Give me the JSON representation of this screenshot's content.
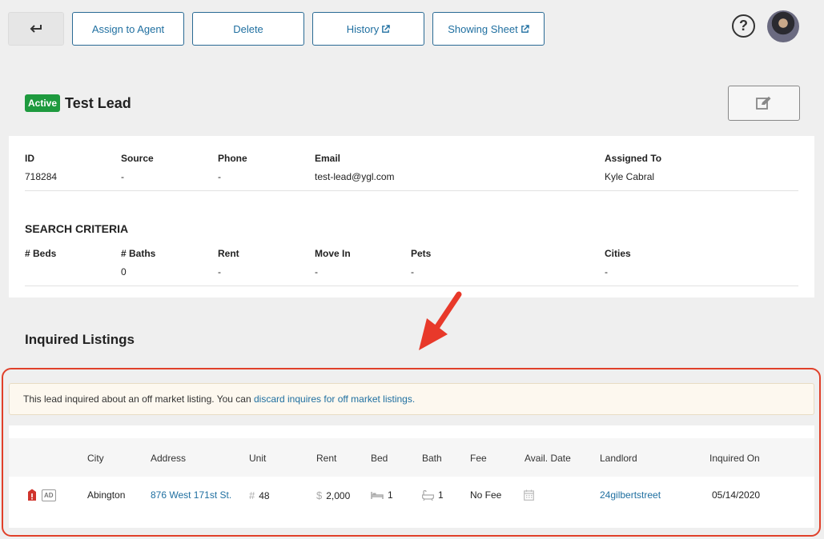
{
  "toolbar": {
    "assign_label": "Assign to Agent",
    "delete_label": "Delete",
    "history_label": "History",
    "showing_sheet_label": "Showing Sheet"
  },
  "lead": {
    "status": "Active",
    "name": "Test Lead"
  },
  "details": {
    "fields": [
      {
        "label": "ID",
        "value": "718284"
      },
      {
        "label": "Source",
        "value": "-"
      },
      {
        "label": "Phone",
        "value": "-"
      },
      {
        "label": "Email",
        "value": "test-lead@ygl.com"
      },
      {
        "label": "Assigned To",
        "value": "Kyle Cabral"
      }
    ]
  },
  "criteria": {
    "title": "SEARCH CRITERIA",
    "fields": [
      {
        "label": "# Beds",
        "value": ""
      },
      {
        "label": "# Baths",
        "value": "0"
      },
      {
        "label": "Rent",
        "value": "-"
      },
      {
        "label": "Move In",
        "value": "-"
      },
      {
        "label": "Pets",
        "value": "-"
      },
      {
        "label": "Cities",
        "value": "-"
      }
    ]
  },
  "inquired": {
    "title": "Inquired Listings",
    "notice_text": "This lead inquired about an off market listing. You can ",
    "notice_link": "discard inquires for off market listings.",
    "columns": [
      "City",
      "Address",
      "Unit",
      "Rent",
      "Bed",
      "Bath",
      "Fee",
      "Avail. Date",
      "Landlord",
      "Inquired On"
    ],
    "row": {
      "ad_badge": "AD",
      "city": "Abington",
      "address": "876 West 171st St.",
      "unit_prefix": "#",
      "unit": "48",
      "rent_prefix": "$",
      "rent": "2,000",
      "bed": "1",
      "bath": "1",
      "fee": "No Fee",
      "landlord": "24gilbertstreet",
      "inquired_on": "05/14/2020"
    }
  },
  "colors": {
    "accent": "#1f6fa0",
    "active_badge": "#1e9a3e",
    "highlight": "#e0402a"
  }
}
